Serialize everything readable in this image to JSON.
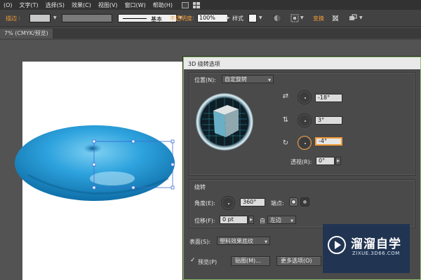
{
  "menubar": {
    "items": [
      "(O)",
      "文字(T)",
      "选择(S)",
      "效果(C)",
      "视图(V)",
      "窗口(W)",
      "帮助(H)"
    ],
    "icons": [
      "br-icon",
      "workspace-grid-icon"
    ]
  },
  "controlbar": {
    "stroke_label": "描边",
    "stroke_profile": "基本",
    "opacity_label": "不透明度",
    "opacity_value": "100%",
    "style_label": "样式",
    "transform_label": "变换",
    "colors": {
      "fill_swatch": "#c8c8c8",
      "stroke_swatch": "#7a7a7a",
      "accent": "#f29c38"
    }
  },
  "document": {
    "tab_label": "7% (CMYK/预览)"
  },
  "artwork": {
    "object": "torus",
    "color": "#1a8fd1"
  },
  "dialog": {
    "title": "3D 绕转选项",
    "position_label": "位置(N):",
    "position_value": "自定旋转",
    "rotation": {
      "x": "-18°",
      "y": "3°",
      "z": "-4°"
    },
    "perspective_label": "透视(R):",
    "perspective_value": "0°",
    "revolve_section": "绕转",
    "angle_label": "角度(E):",
    "angle_value": "360°",
    "caps_label": "端点:",
    "offset_label": "位移(F):",
    "offset_value": "0 pt",
    "from_label": "自",
    "from_value": "左边",
    "surface_label": "表面(S):",
    "surface_value": "塑料效果底纹",
    "preview_label": "预览(P)",
    "map_button": "贴图(M)...",
    "more_options_button": "更多选项(O)"
  },
  "watermark": {
    "title": "溜溜自学",
    "url": "ZIXUE.3D66.COM"
  }
}
